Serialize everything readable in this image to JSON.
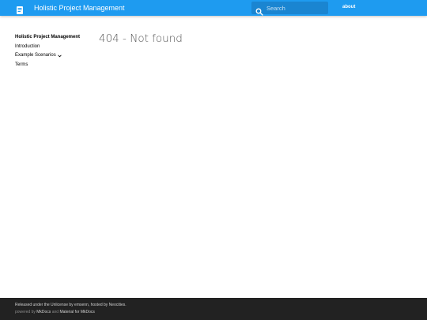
{
  "header": {
    "title": "Holistic Project Management",
    "logo_icon": "book-icon",
    "search": {
      "placeholder": "Search",
      "value": ""
    },
    "about_link": "about",
    "bg_color": "#1e9bf0"
  },
  "sidebar": {
    "title": "Holistic Project Management",
    "items": [
      {
        "label": "Introduction"
      },
      {
        "label": "Example Scenarios",
        "icon": "chevron-down-icon"
      },
      {
        "label": "Terms"
      }
    ]
  },
  "main": {
    "title": "404 - Not found"
  },
  "footer": {
    "line1": "Released under the Unlicense by emsenn, hosted by Neocities.",
    "line2": {
      "prefix": "powered by",
      "link1": "MkDocs",
      "middle": "and",
      "link2": "Material for MkDocs"
    },
    "bg_color": "#222222"
  }
}
